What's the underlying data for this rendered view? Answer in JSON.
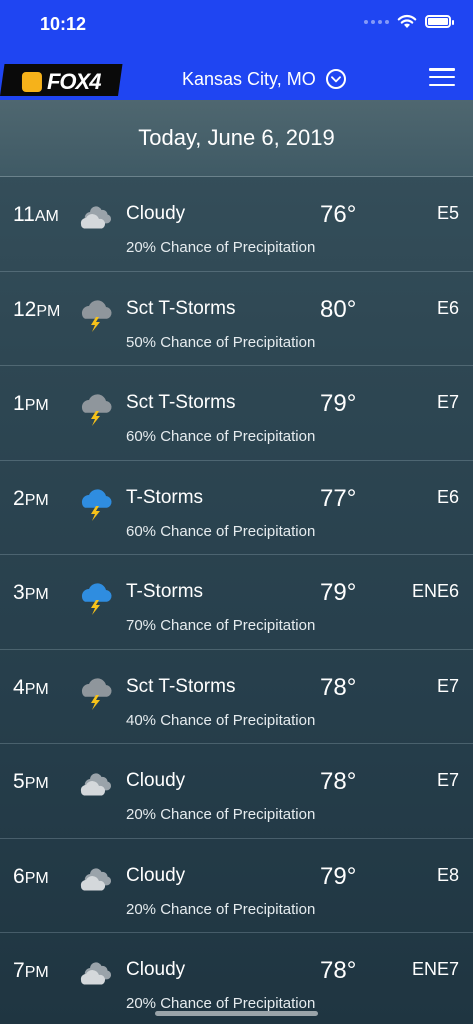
{
  "status_bar": {
    "time": "10:12"
  },
  "header": {
    "logo_text": "FOX4",
    "location": "Kansas City, MO"
  },
  "date_title": "Today, June 6, 2019",
  "colors": {
    "header_blue": "#1f45f2",
    "logo_yellow": "#f6b21a",
    "storm_blue": "#2f8de0",
    "bolt_yellow": "#f6c21a"
  },
  "rows": [
    {
      "hour": "11",
      "ampm": "AM",
      "icon": "cloudy-icon",
      "condition": "Cloudy",
      "temp": "76°",
      "wind": "E5",
      "precip": "20% Chance of Precipitation"
    },
    {
      "hour": "12",
      "ampm": "PM",
      "icon": "scattered-thunderstorm-icon",
      "condition": "Sct T-Storms",
      "temp": "80°",
      "wind": "E6",
      "precip": "50% Chance of Precipitation"
    },
    {
      "hour": "1",
      "ampm": "PM",
      "icon": "scattered-thunderstorm-icon",
      "condition": "Sct T-Storms",
      "temp": "79°",
      "wind": "E7",
      "precip": "60% Chance of Precipitation"
    },
    {
      "hour": "2",
      "ampm": "PM",
      "icon": "thunderstorm-icon",
      "condition": "T-Storms",
      "temp": "77°",
      "wind": "E6",
      "precip": "60% Chance of Precipitation"
    },
    {
      "hour": "3",
      "ampm": "PM",
      "icon": "thunderstorm-icon",
      "condition": "T-Storms",
      "temp": "79°",
      "wind": "ENE6",
      "precip": "70% Chance of Precipitation"
    },
    {
      "hour": "4",
      "ampm": "PM",
      "icon": "scattered-thunderstorm-icon",
      "condition": "Sct T-Storms",
      "temp": "78°",
      "wind": "E7",
      "precip": "40% Chance of Precipitation"
    },
    {
      "hour": "5",
      "ampm": "PM",
      "icon": "cloudy-icon",
      "condition": "Cloudy",
      "temp": "78°",
      "wind": "E7",
      "precip": "20% Chance of Precipitation"
    },
    {
      "hour": "6",
      "ampm": "PM",
      "icon": "cloudy-icon",
      "condition": "Cloudy",
      "temp": "79°",
      "wind": "E8",
      "precip": "20% Chance of Precipitation"
    },
    {
      "hour": "7",
      "ampm": "PM",
      "icon": "cloudy-icon",
      "condition": "Cloudy",
      "temp": "78°",
      "wind": "ENE7",
      "precip": "20% Chance of Precipitation"
    }
  ]
}
